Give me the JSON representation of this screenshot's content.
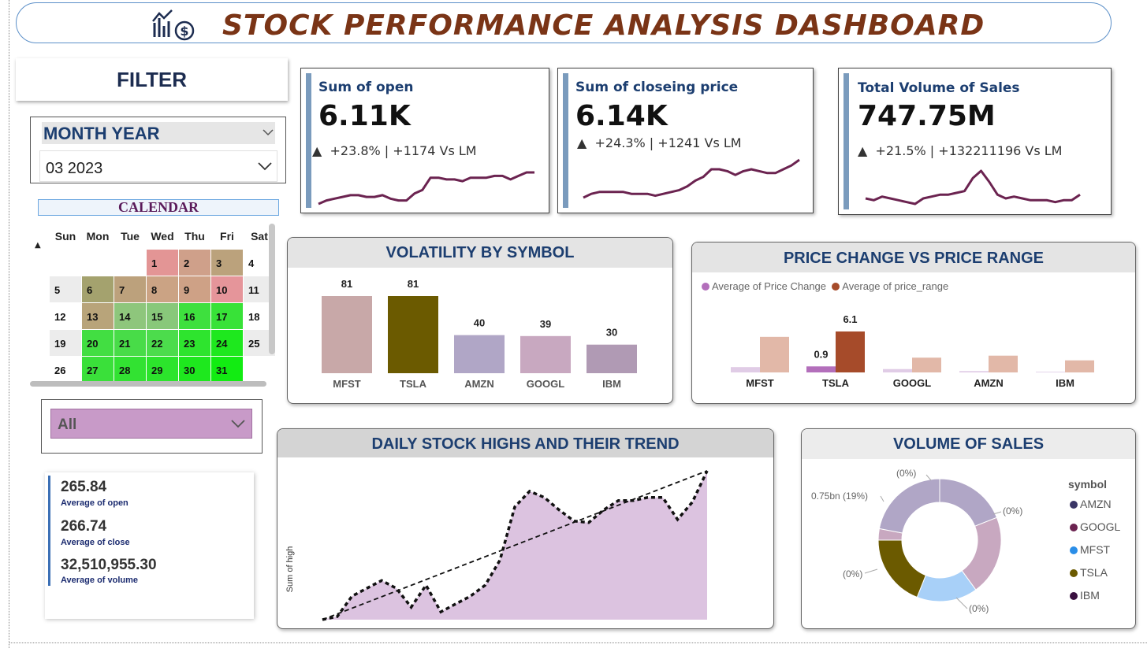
{
  "header": {
    "title": "STOCK PERFORMANCE ANALYSIS DASHBOARD",
    "icon": "chart-dollar-icon"
  },
  "filter": {
    "title": "FILTER"
  },
  "month_slicer": {
    "label": "MONTH YEAR",
    "value": "03 2023"
  },
  "calendar": {
    "label": "CALENDAR",
    "weekdays": [
      "Sun",
      "Mon",
      "Tue",
      "Wed",
      "Thu",
      "Fri",
      "Sat"
    ],
    "days": [
      {
        "d": "1",
        "c": "#e39595"
      },
      {
        "d": "2",
        "c": "#cfa08a"
      },
      {
        "d": "3",
        "c": "#bba27c"
      },
      {
        "d": "4",
        "c": "#ffffff"
      },
      {
        "d": "5",
        "c": "#ececec"
      },
      {
        "d": "6",
        "c": "#a4a26e"
      },
      {
        "d": "7",
        "c": "#bca17c"
      },
      {
        "d": "8",
        "c": "#cba384"
      },
      {
        "d": "9",
        "c": "#cea186"
      },
      {
        "d": "10",
        "c": "#e5959a"
      },
      {
        "d": "11",
        "c": "#ececec"
      },
      {
        "d": "12",
        "c": "#ffffff"
      },
      {
        "d": "13",
        "c": "#b8a47a"
      },
      {
        "d": "14",
        "c": "#8ec67c"
      },
      {
        "d": "15",
        "c": "#88c87a"
      },
      {
        "d": "16",
        "c": "#3ee03e"
      },
      {
        "d": "17",
        "c": "#38e238"
      },
      {
        "d": "18",
        "c": "#ffffff"
      },
      {
        "d": "19",
        "c": "#ececec"
      },
      {
        "d": "20",
        "c": "#42de42"
      },
      {
        "d": "21",
        "c": "#48dc48"
      },
      {
        "d": "22",
        "c": "#4cdc4c"
      },
      {
        "d": "23",
        "c": "#2ee42e"
      },
      {
        "d": "24",
        "c": "#1ee81e"
      },
      {
        "d": "25",
        "c": "#ececec"
      },
      {
        "d": "26",
        "c": "#ffffff"
      },
      {
        "d": "27",
        "c": "#3ae03a"
      },
      {
        "d": "28",
        "c": "#32e232"
      },
      {
        "d": "29",
        "c": "#2ce42c"
      },
      {
        "d": "30",
        "c": "#1ee81e"
      },
      {
        "d": "31",
        "c": "#12ec12"
      },
      {
        "d": "",
        "c": "#ffffff"
      }
    ]
  },
  "symbol_slicer": {
    "value": "All"
  },
  "averages": {
    "open_value": "265.84",
    "open_label": "Average of open",
    "close_value": "266.74",
    "close_label": "Average of close",
    "volume_value": "32,510,955.30",
    "volume_label": "Average of volume"
  },
  "kpis": [
    {
      "title": "Sum of open",
      "value": "6.11K",
      "arrow": "▲",
      "delta": "+23.8% | +1174 Vs LM"
    },
    {
      "title": "Sum of closeing price",
      "value": "6.14K",
      "arrow": "▲",
      "delta": "+24.3% | +1241 Vs LM"
    },
    {
      "title": "Total Volume of Sales",
      "value": "747.75M",
      "arrow": "▲",
      "delta": "+21.5% | +132211196 Vs LM"
    }
  ],
  "colors": {
    "spark": "#6b2350",
    "kpi_accent": "#7a9bbd",
    "panel_title": "#1c3e70",
    "area_fill": "#dcc3e0",
    "series_price_change": "#b36fbb",
    "series_price_range": "#a64b2a"
  },
  "chart_data": [
    {
      "type": "line",
      "name_ref": "Sum of open sparkline",
      "values": [
        10,
        12,
        13,
        14,
        15,
        15,
        14,
        14,
        15,
        13,
        12,
        12,
        16,
        18,
        25,
        25,
        24,
        24,
        23,
        25,
        25,
        25,
        26,
        26,
        24,
        26,
        28,
        28
      ]
    },
    {
      "type": "line",
      "name_ref": "Sum of closeing price sparkline",
      "values": [
        12,
        14,
        15,
        15,
        15,
        15,
        14,
        14,
        14,
        13,
        14,
        15,
        16,
        18,
        21,
        23,
        27,
        27,
        26,
        24,
        26,
        27,
        26,
        25,
        25,
        27,
        29,
        32
      ]
    },
    {
      "type": "line",
      "name_ref": "Total Volume of Sales sparkline",
      "values": [
        15,
        14,
        16,
        15,
        14,
        13,
        12,
        15,
        16,
        17,
        17,
        18,
        19,
        26,
        30,
        24,
        17,
        15,
        16,
        15,
        14,
        14,
        14,
        13,
        14,
        14,
        17
      ]
    },
    {
      "type": "bar",
      "title": "VOLATILITY BY SYMBOL",
      "categories": [
        "MFST",
        "TSLA",
        "AMZN",
        "GOOGL",
        "IBM"
      ],
      "values": [
        81,
        81,
        40,
        39,
        30
      ],
      "colors": [
        "#c8a8a8",
        "#6b5a00",
        "#b0a6c6",
        "#c8a8c0",
        "#b09ab4"
      ],
      "ylim": [
        0,
        81
      ]
    },
    {
      "type": "bar",
      "title": "PRICE CHANGE VS PRICE RANGE",
      "categories": [
        "MFST",
        "TSLA",
        "GOOGL",
        "AMZN",
        "IBM"
      ],
      "series": [
        {
          "name": "Average of Price Change",
          "values": [
            0.8,
            0.9,
            0.5,
            0.2,
            0.1
          ],
          "labels": [
            "",
            "0.9",
            "",
            "",
            ""
          ],
          "colors": [
            "#e0cce6",
            "#b36fbb",
            "#e0cce6",
            "#e0cce6",
            "#e0cce6"
          ]
        },
        {
          "name": "Average of price_range",
          "values": [
            5.3,
            6.1,
            2.2,
            2.5,
            1.8
          ],
          "labels": [
            "",
            "6.1",
            "",
            "",
            ""
          ],
          "colors": [
            "#e2b8a8",
            "#a64b2a",
            "#e2b8a8",
            "#e2b8a8",
            "#e2b8a8"
          ]
        }
      ],
      "ylim": [
        0,
        6.1
      ]
    },
    {
      "type": "area",
      "title": "DAILY STOCK HIGHS AND THEIR TREND",
      "ylabel": "Sum of high",
      "values": [
        0,
        2,
        15,
        20,
        25,
        20,
        8,
        22,
        5,
        10,
        15,
        22,
        38,
        72,
        82,
        78,
        70,
        63,
        62,
        70,
        76,
        76,
        78,
        78,
        64,
        75,
        95
      ],
      "trend": [
        0,
        95
      ],
      "ylim": [
        0,
        95
      ]
    },
    {
      "type": "pie",
      "title": "VOLUME OF SALES",
      "legend_title": "symbol",
      "legend": [
        {
          "name": "AMZN",
          "color": "#3a3566"
        },
        {
          "name": "GOOGL",
          "color": "#6b2350"
        },
        {
          "name": "MFST",
          "color": "#2a8ee8"
        },
        {
          "name": "TSLA",
          "color": "#6b5a00"
        },
        {
          "name": "IBM",
          "color": "#3a1040"
        }
      ],
      "slices": [
        {
          "label": "(0%)",
          "value": 0.19,
          "color": "#b0a6c6"
        },
        {
          "label": "(0%)",
          "value": 0.21,
          "color": "#c8a8c0"
        },
        {
          "label": "(0%)",
          "value": 0.16,
          "color": "#a8d0f8"
        },
        {
          "label": "0.75bn (19%)",
          "value": 0.19,
          "color": "#6b5a00"
        },
        {
          "label": "(0%)",
          "value": 0.03,
          "color": "#c8a8c0"
        },
        {
          "label": "",
          "value": 0.22,
          "color": "#b0a6c6"
        }
      ]
    }
  ]
}
